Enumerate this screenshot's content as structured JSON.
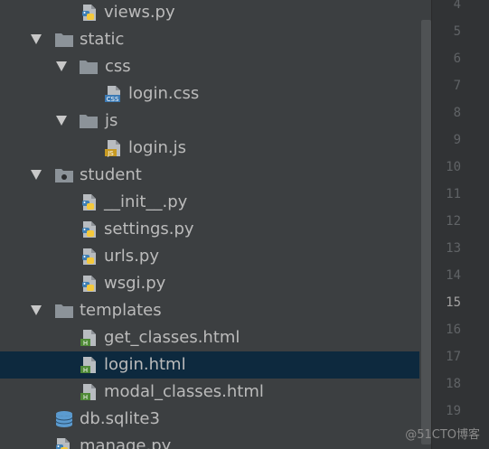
{
  "tree": [
    {
      "label": "views.py",
      "icon": "python-file-icon",
      "arrow": false,
      "depth": 3,
      "selected": false
    },
    {
      "label": "static",
      "icon": "folder-icon",
      "arrow": "expanded",
      "depth": 1,
      "selected": false
    },
    {
      "label": "css",
      "icon": "folder-icon",
      "arrow": "expanded",
      "depth": 2,
      "selected": false
    },
    {
      "label": "login.css",
      "icon": "css-file-icon",
      "arrow": false,
      "depth": 4,
      "selected": false
    },
    {
      "label": "js",
      "icon": "folder-icon",
      "arrow": "expanded",
      "depth": 2,
      "selected": false
    },
    {
      "label": "login.js",
      "icon": "js-file-icon",
      "arrow": false,
      "depth": 4,
      "selected": false
    },
    {
      "label": "student",
      "icon": "package-folder-icon",
      "arrow": "expanded",
      "depth": 1,
      "selected": false
    },
    {
      "label": "__init__.py",
      "icon": "python-file-icon",
      "arrow": false,
      "depth": 3,
      "selected": false
    },
    {
      "label": "settings.py",
      "icon": "python-file-icon",
      "arrow": false,
      "depth": 3,
      "selected": false
    },
    {
      "label": "urls.py",
      "icon": "python-file-icon",
      "arrow": false,
      "depth": 3,
      "selected": false
    },
    {
      "label": "wsgi.py",
      "icon": "python-file-icon",
      "arrow": false,
      "depth": 3,
      "selected": false
    },
    {
      "label": "templates",
      "icon": "folder-icon",
      "arrow": "expanded",
      "depth": 1,
      "selected": false
    },
    {
      "label": "get_classes.html",
      "icon": "html-file-icon",
      "arrow": false,
      "depth": 3,
      "selected": false
    },
    {
      "label": "login.html",
      "icon": "html-file-icon",
      "arrow": false,
      "depth": 3,
      "selected": true
    },
    {
      "label": "modal_classes.html",
      "icon": "html-file-icon",
      "arrow": false,
      "depth": 3,
      "selected": false
    },
    {
      "label": "db.sqlite3",
      "icon": "database-icon",
      "arrow": false,
      "depth": 2,
      "selected": false
    },
    {
      "label": "manage.py",
      "icon": "python-file-icon",
      "arrow": false,
      "depth": 2,
      "selected": false
    }
  ],
  "gutter": {
    "lines": [
      "4",
      "5",
      "6",
      "7",
      "8",
      "9",
      "10",
      "11",
      "12",
      "13",
      "14",
      "15",
      "16",
      "17",
      "18",
      "19"
    ],
    "current_line": "15"
  },
  "watermark": "@51CTO博客",
  "colors": {
    "background": "#3c3f41",
    "selection": "#0d293e",
    "text": "#bbbbbb",
    "folder": "#8c9399",
    "python_blue": "#3e7fb5",
    "python_yellow": "#f5c93c",
    "css_badge": "#3b79b3",
    "js_badge": "#c79a22",
    "html_badge": "#4f8a37",
    "database": "#5b9bd0"
  }
}
